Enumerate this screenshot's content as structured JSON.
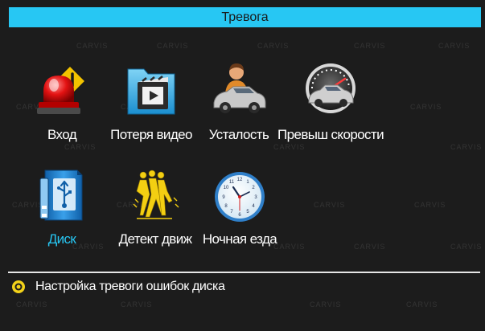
{
  "title": "Тревога",
  "watermark": "CARVIS",
  "menu": [
    {
      "label": "Вход",
      "icon": "alarm-siren-icon",
      "selected": false
    },
    {
      "label": "Потеря видео",
      "icon": "video-folder-icon",
      "selected": false
    },
    {
      "label": "Усталость",
      "icon": "driver-car-icon",
      "selected": false
    },
    {
      "label": "Превыш скорости",
      "icon": "speedometer-car-icon",
      "selected": false
    },
    {
      "label": "Диск",
      "icon": "usb-disk-icon",
      "selected": true
    },
    {
      "label": "Детект движ",
      "icon": "motion-figures-icon",
      "selected": false
    },
    {
      "label": "Ночная езда",
      "icon": "clock-icon",
      "selected": false
    }
  ],
  "hint": {
    "icon": "radio-bullet-icon",
    "text": "Настройка тревоги ошибок диска"
  },
  "colors": {
    "background": "#1c1c1c",
    "title_bar": "#27c7f3",
    "selected_label": "#27c7f3",
    "text": "#ffffff"
  }
}
